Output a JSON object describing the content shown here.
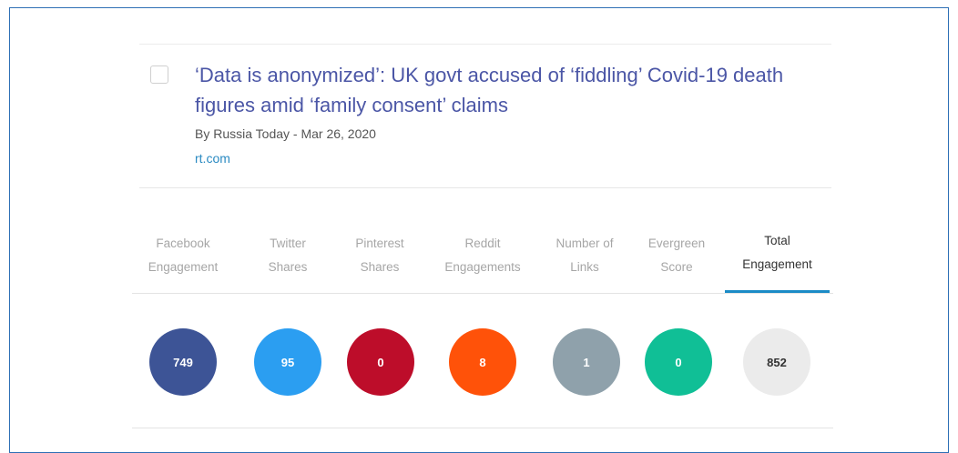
{
  "article": {
    "title": "‘Data is anonymized’: UK govt accused of ‘fiddling’ Covid-19 death figures amid ‘family consent’ claims",
    "byline": "By Russia Today - Mar 26, 2020",
    "domain": "rt.com"
  },
  "metrics": [
    {
      "label": "Facebook Engagement",
      "value": "749",
      "color": "#3d5496",
      "active": false
    },
    {
      "label": "Twitter Shares",
      "value": "95",
      "color": "#2b9ef1",
      "active": false
    },
    {
      "label": "Pinterest Shares",
      "value": "0",
      "color": "#bd0d2a",
      "active": false
    },
    {
      "label": "Reddit Engagements",
      "value": "8",
      "color": "#ff5209",
      "active": false
    },
    {
      "label": "Number of Links",
      "value": "1",
      "color": "#8fa1ab",
      "active": false
    },
    {
      "label": "Evergreen Score",
      "value": "0",
      "color": "#10bf96",
      "active": false
    },
    {
      "label": "Total Engagement",
      "value": "852",
      "color": "#ebebeb",
      "active": true
    }
  ],
  "colors": {
    "title": "#4b56a6",
    "link": "#2a8ac2",
    "active_tab_underline": "#1a8bc6",
    "frame_border": "#2e6fb5"
  }
}
